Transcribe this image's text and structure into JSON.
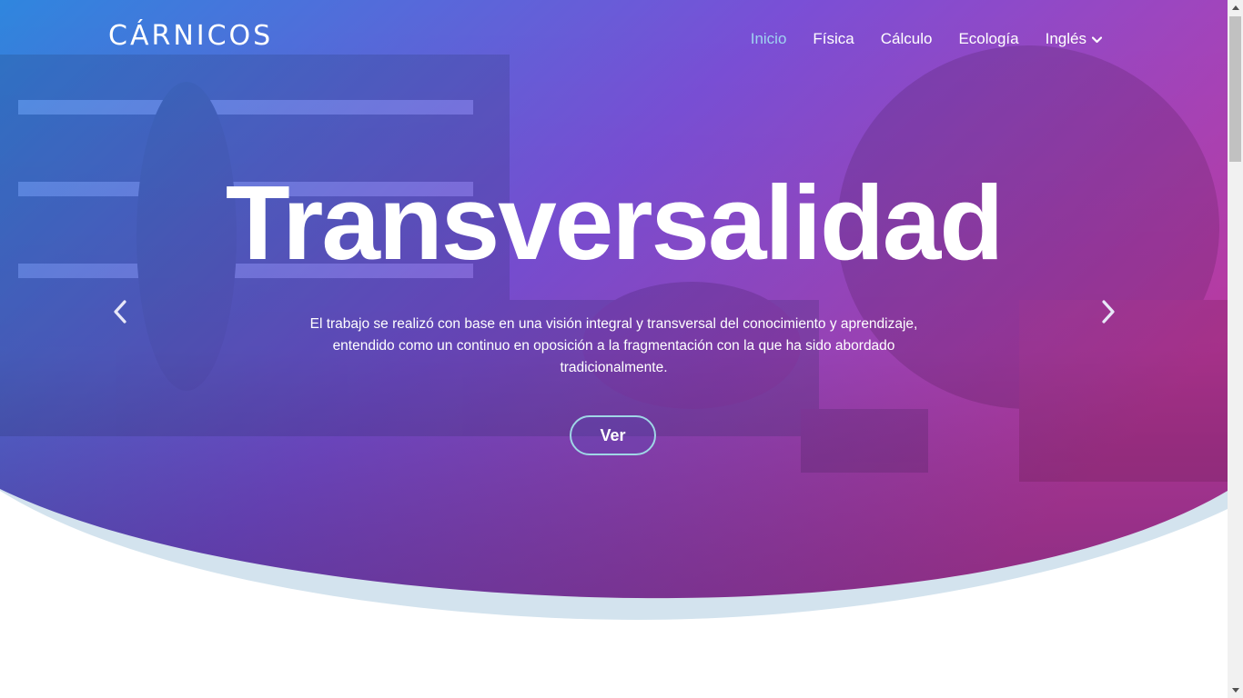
{
  "brand": "CÁRNICOS",
  "nav": {
    "items": [
      {
        "label": "Inicio",
        "active": true
      },
      {
        "label": "Física"
      },
      {
        "label": "Cálculo"
      },
      {
        "label": "Ecología"
      },
      {
        "label": "Inglés",
        "dropdown": true
      }
    ]
  },
  "hero": {
    "title": "Transversalidad",
    "description": "El trabajo se realizó con base en una visión integral y transversal del conocimiento y aprendizaje, entendido como un continuo en oposición a la fragmentación con la que ha sido abordado tradicionalmente.",
    "button_label": "Ver"
  },
  "icons": {
    "prev": "chevron-left-icon",
    "next": "chevron-right-icon",
    "dropdown": "chevron-down-icon"
  },
  "colors": {
    "gradient_start": "#2f86de",
    "gradient_mid": "#7a4fd6",
    "gradient_end": "#c23ca6",
    "active_nav": "#9fd3f0",
    "wave_light": "#d3e3ee"
  }
}
